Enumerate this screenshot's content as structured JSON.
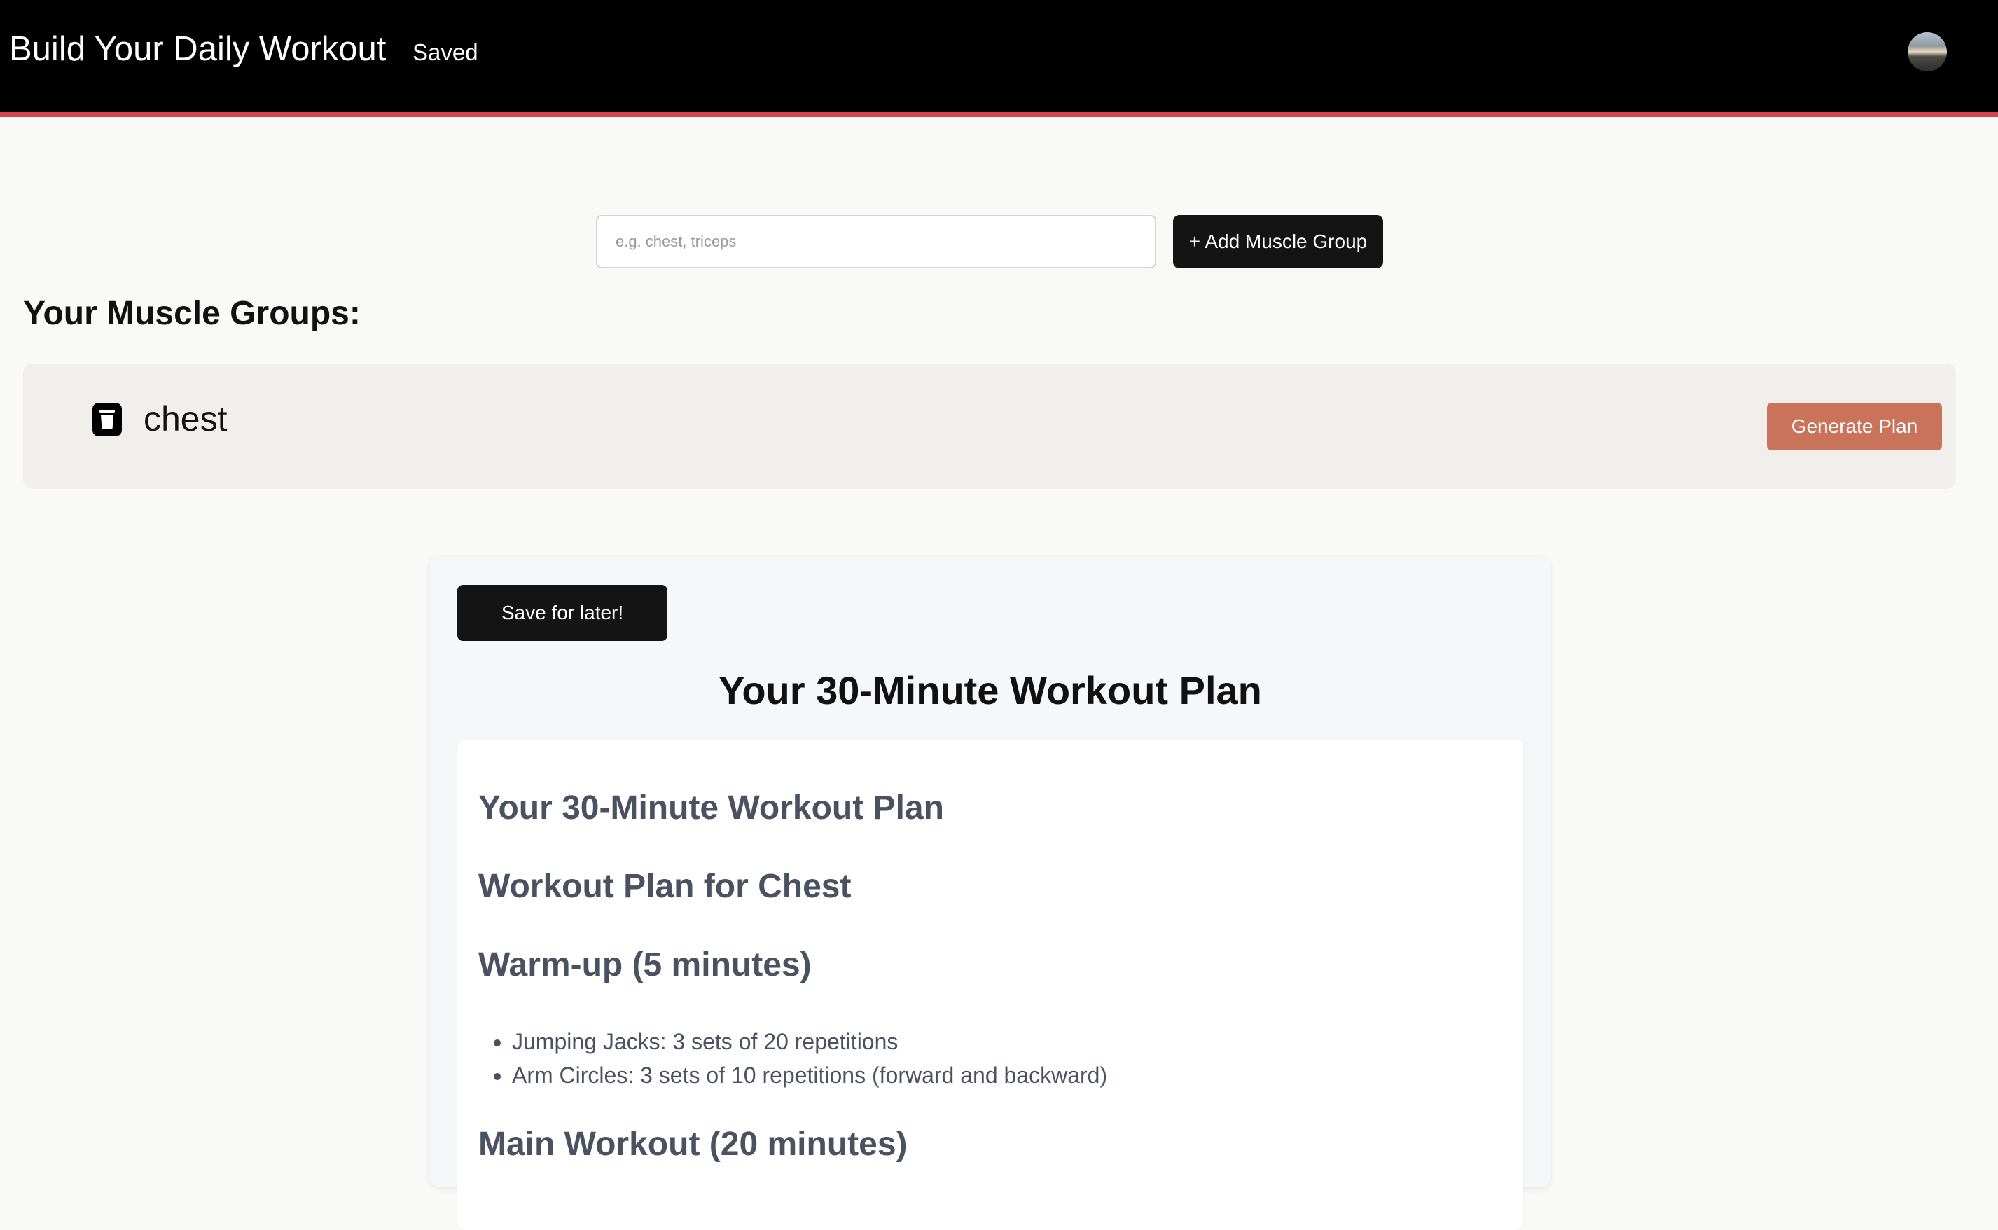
{
  "header": {
    "title": "Build Your Daily Workout",
    "nav_saved": "Saved",
    "accent_color": "#d9434b"
  },
  "search": {
    "placeholder": "e.g. chest, triceps",
    "value": ""
  },
  "add_button": {
    "label": "+ Add Muscle Group"
  },
  "muscle_groups": {
    "heading": "Your Muscle Groups:",
    "items": [
      {
        "label": "chest",
        "icon": "trash-icon"
      }
    ],
    "generate_label": "Generate Plan",
    "generate_color": "#c9735b"
  },
  "plan": {
    "save_label": "Save for later!",
    "title": "Your 30-Minute Workout Plan",
    "content": {
      "heading1": "Your 30-Minute Workout Plan",
      "heading2": "Workout Plan for Chest",
      "warmup_heading": "Warm-up (5 minutes)",
      "warmup_items": [
        "Jumping Jacks: 3 sets of 20 repetitions",
        "Arm Circles: 3 sets of 10 repetitions (forward and backward)"
      ],
      "main_heading": "Main Workout (20 minutes)"
    }
  }
}
